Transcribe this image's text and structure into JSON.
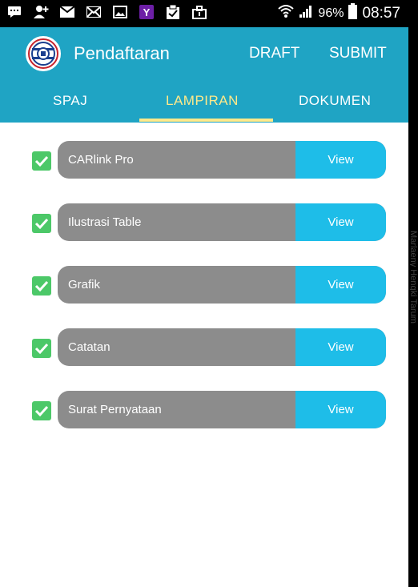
{
  "status_bar": {
    "battery": "96%",
    "time": "08:57",
    "icons": [
      "chat-icon",
      "add-person-icon",
      "mail-icon",
      "mail-open-icon",
      "image-icon",
      "yahoo-icon",
      "clipboard-check-icon",
      "briefcase-icon"
    ]
  },
  "appbar": {
    "title": "Pendaftaran",
    "draft_label": "DRAFT",
    "submit_label": "SUBMIT",
    "color": "#1fa4c4"
  },
  "tabs": [
    {
      "label": "SPAJ",
      "selected": false
    },
    {
      "label": "LAMPIRAN",
      "selected": true
    },
    {
      "label": "DOKUMEN",
      "selected": false
    }
  ],
  "attachments": [
    {
      "label": "CARlink Pro",
      "checked": true,
      "action": "View"
    },
    {
      "label": "Ilustrasi Table",
      "checked": true,
      "action": "View"
    },
    {
      "label": "Grafik",
      "checked": true,
      "action": "View"
    },
    {
      "label": "Catatan",
      "checked": true,
      "action": "View"
    },
    {
      "label": "Surat Pernyataan",
      "checked": true,
      "action": "View"
    }
  ],
  "side_text": "Marlaeny Hengki Tarum",
  "colors": {
    "accent": "#ffe98a",
    "view_button": "#1ebde8",
    "row_bar": "#8c8c8c",
    "checkbox": "#4cc868"
  }
}
